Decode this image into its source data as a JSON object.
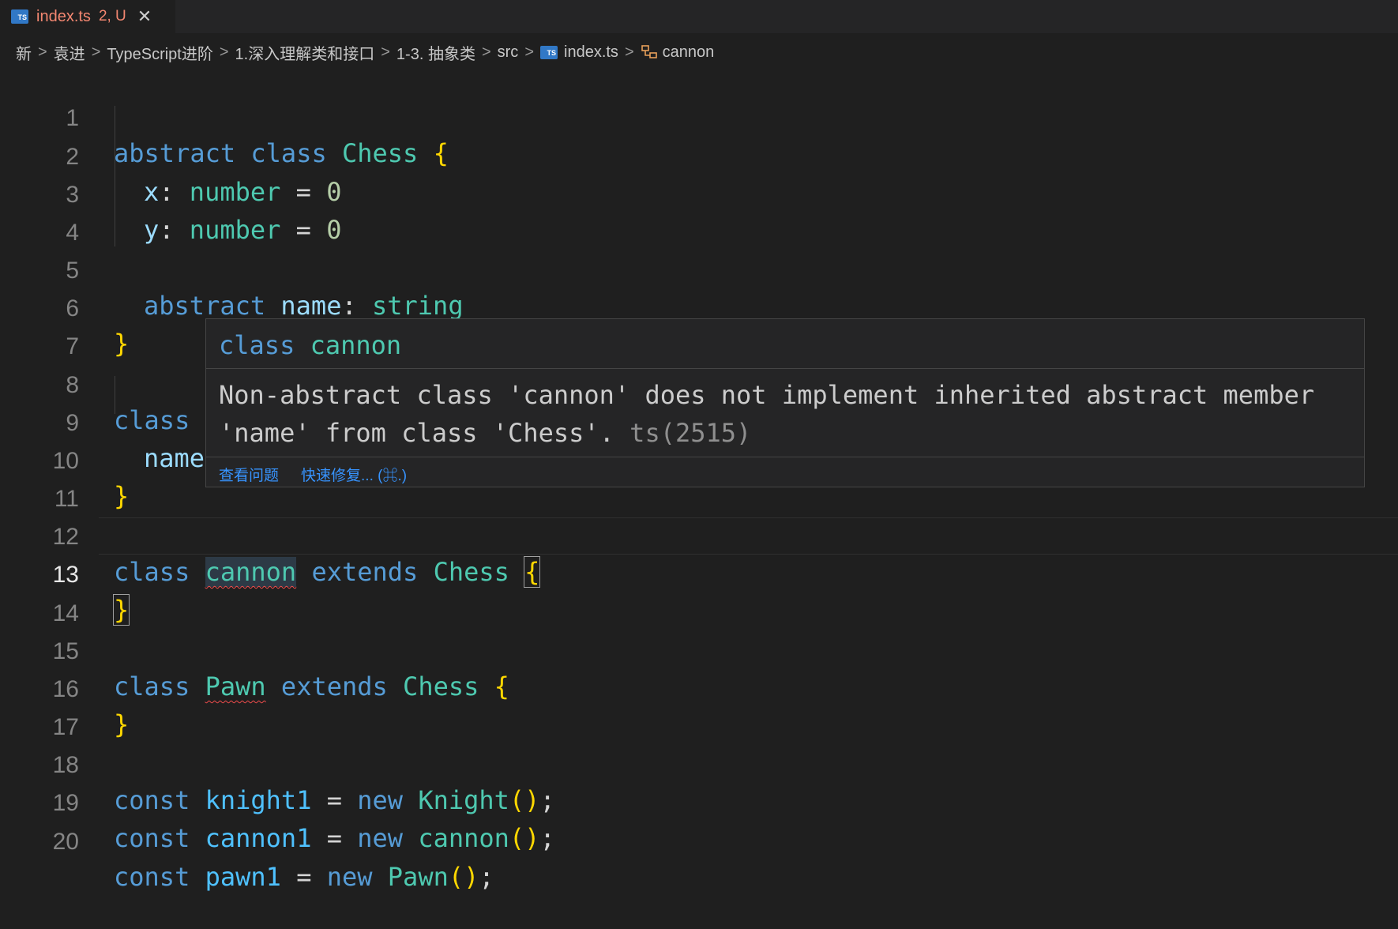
{
  "tab": {
    "icon_label": "TS",
    "filename": "index.ts",
    "status": "2, U",
    "close_glyph": "✕"
  },
  "breadcrumb": {
    "items": [
      "新",
      "袁进",
      "TypeScript进阶",
      "1.深入理解类和接口",
      "1-3. 抽象类",
      "src"
    ],
    "file": "index.ts",
    "symbol": "cannon",
    "separator": ">"
  },
  "editor": {
    "active_line": 13,
    "lines": [
      {
        "n": "1"
      },
      {
        "n": "2"
      },
      {
        "n": "3"
      },
      {
        "n": "4"
      },
      {
        "n": "5"
      },
      {
        "n": "6"
      },
      {
        "n": "7"
      },
      {
        "n": "8"
      },
      {
        "n": "9"
      },
      {
        "n": "10"
      },
      {
        "n": "11"
      },
      {
        "n": "12"
      },
      {
        "n": "13"
      },
      {
        "n": "14"
      },
      {
        "n": "15"
      },
      {
        "n": "16"
      },
      {
        "n": "17"
      },
      {
        "n": "18"
      },
      {
        "n": "19"
      },
      {
        "n": "20"
      }
    ],
    "tokens": {
      "abstract": "abstract",
      "class": "class",
      "extends": "extends",
      "const": "const",
      "new": "new",
      "Chess": "Chess",
      "x": "x",
      "y": "y",
      "number": "number",
      "zero": "0",
      "name": "name",
      "string": "string",
      "cannon": "cannon",
      "Pawn": "Pawn",
      "knight1": "knight1",
      "cannon1": "cannon1",
      "pawn1": "pawn1",
      "Knight": "Knight"
    }
  },
  "hover": {
    "sig_kw": "class",
    "sig_name": "cannon",
    "message": "Non-abstract class 'cannon' does not implement inherited abstract member 'name' from class 'Chess'.",
    "code": "ts(2515)",
    "action_view": "查看问题",
    "action_fix": "快速修复... (⌘.)"
  },
  "colors": {
    "keyword": "#569cd6",
    "type": "#4ec9b0",
    "property": "#9cdcfe",
    "number": "#b5cea8",
    "bracket": "#ffd700",
    "error": "#f14c4c",
    "link": "#3794ff"
  }
}
